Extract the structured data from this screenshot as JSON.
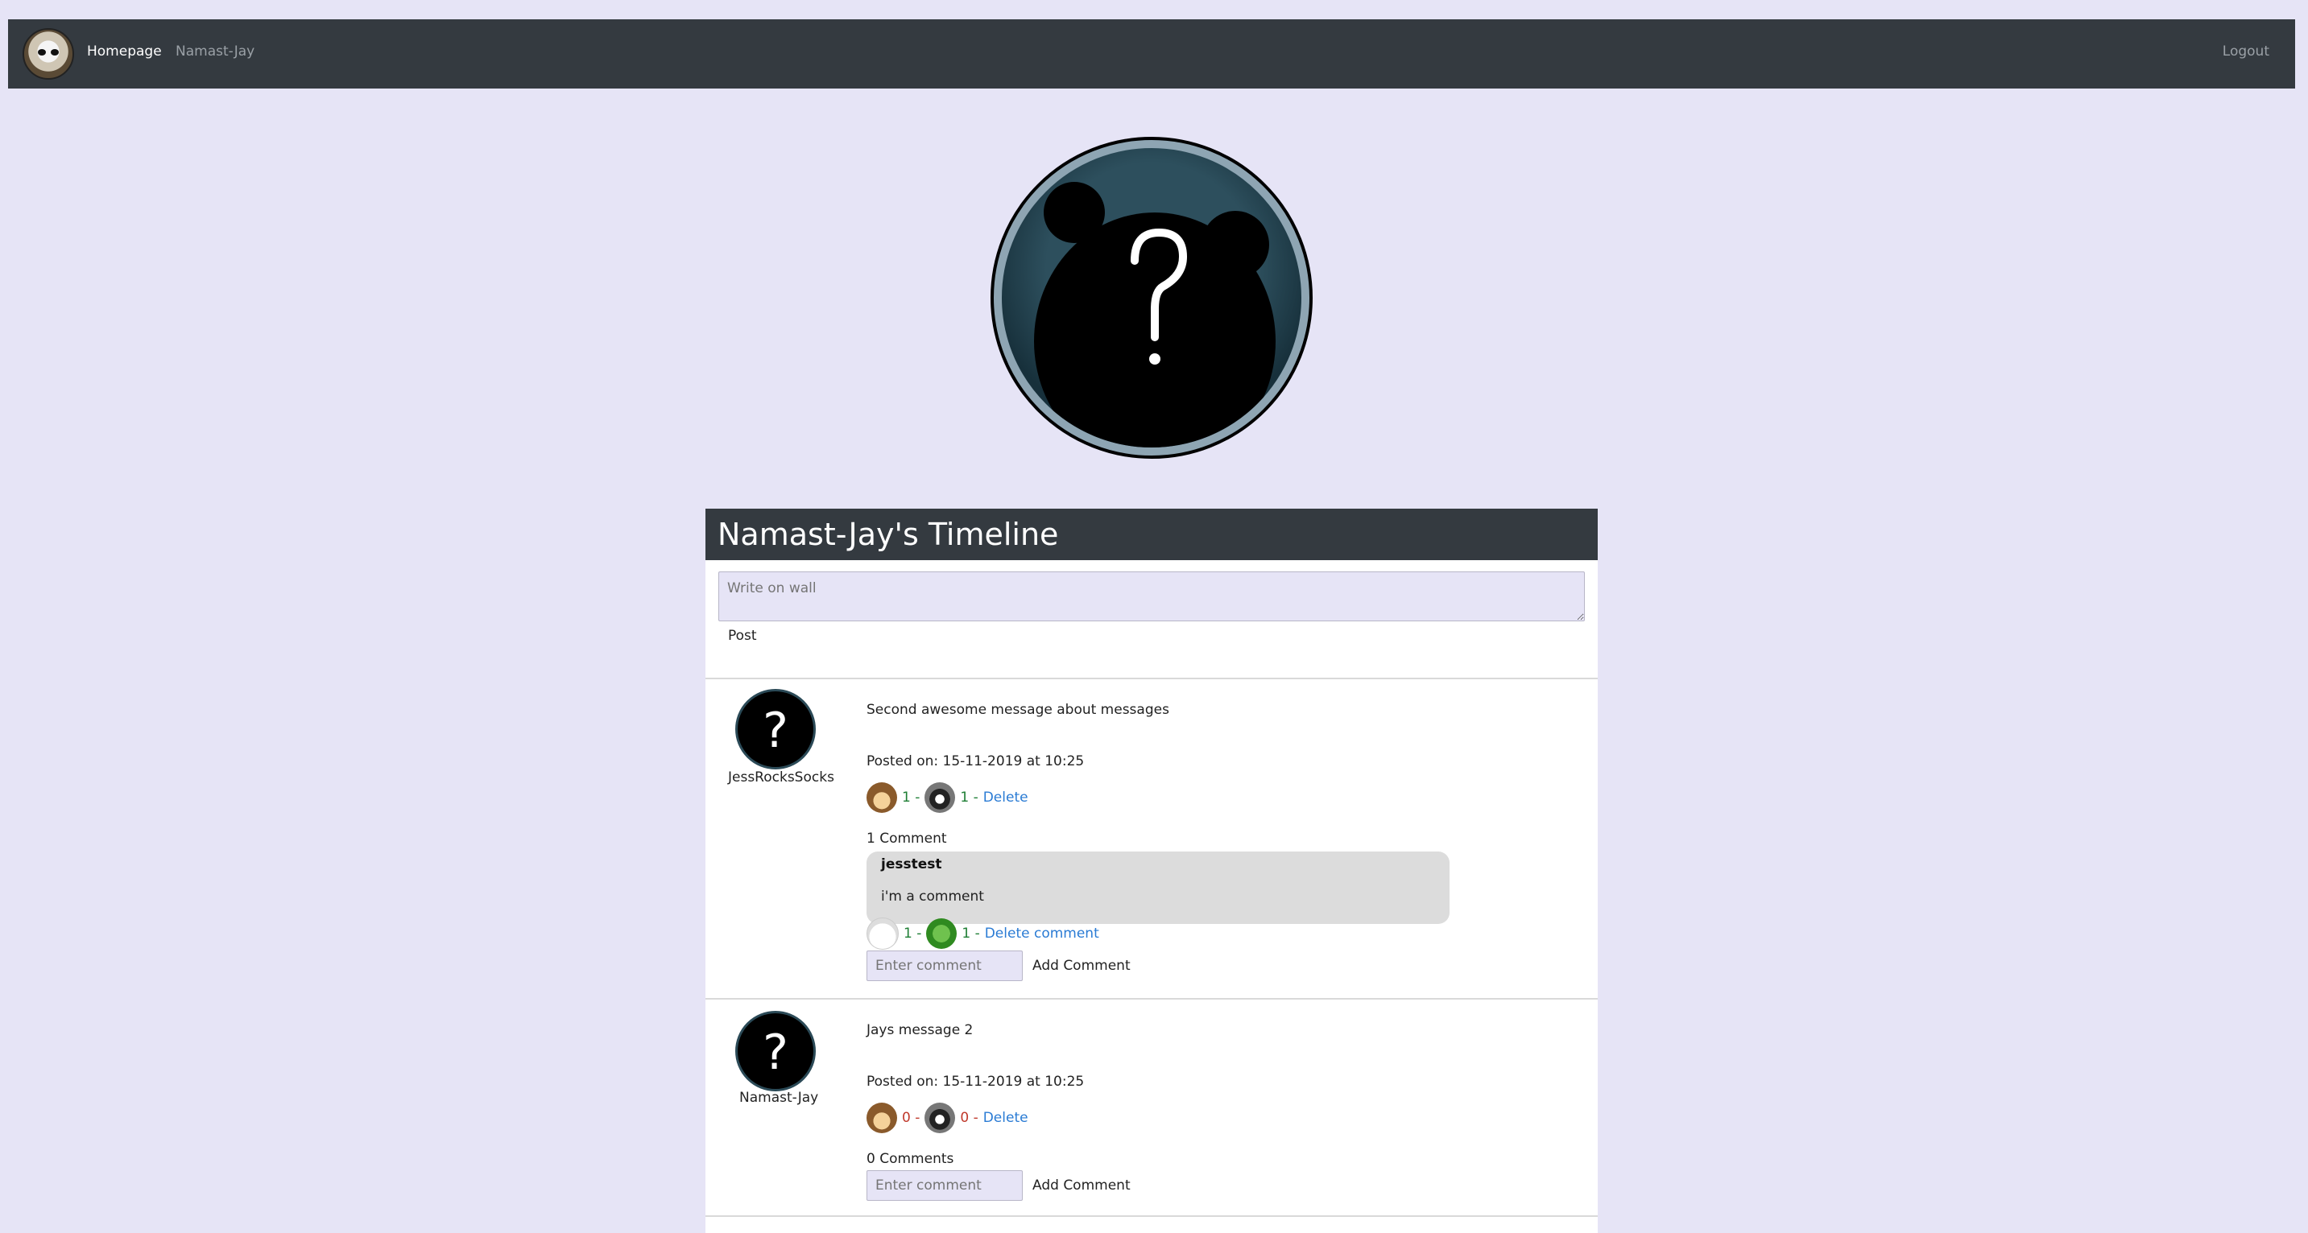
{
  "nav": {
    "brand_icon": "ferret-logo-icon",
    "home_label": "Homepage",
    "user_label": "Namast-Jay",
    "logout_label": "Logout"
  },
  "profile": {
    "avatar_icon": "unknown-user-avatar-icon"
  },
  "timeline": {
    "title": "Namast-Jay's Timeline",
    "wall_placeholder": "Write on wall",
    "post_label": "Post"
  },
  "posts": [
    {
      "author": "JessRocksSocks",
      "message": "Second awesome message about messages",
      "posted": "Posted on: 15-11-2019 at 10:25",
      "reactions": [
        {
          "icon": "hedgehog-icon",
          "count": "1 -"
        },
        {
          "icon": "badger-icon",
          "count": "1 -"
        }
      ],
      "delete_label": "Delete",
      "comment_count": "1 Comment",
      "comments": [
        {
          "author": "jesstest",
          "text": "i'm a comment",
          "reactions": [
            {
              "icon": "rabbit-icon",
              "count": "1 -"
            },
            {
              "icon": "snake-icon",
              "count": "1 -"
            }
          ],
          "delete_label": "Delete comment"
        }
      ],
      "comment_placeholder": "Enter comment",
      "add_comment_label": "Add Comment"
    },
    {
      "author": "Namast-Jay",
      "message": "Jays message 2",
      "posted": "Posted on: 15-11-2019 at 10:25",
      "reactions": [
        {
          "icon": "hedgehog-icon",
          "count": "0 -"
        },
        {
          "icon": "badger-icon",
          "count": "0 -"
        }
      ],
      "delete_label": "Delete",
      "comment_count": "0 Comments",
      "comments": [],
      "comment_placeholder": "Enter comment",
      "add_comment_label": "Add Comment"
    }
  ],
  "colors": {
    "page_bg": "#e6e4f6",
    "navbar_bg": "#343a40",
    "link": "#2a7bd4",
    "count_positive": "#1e7e34",
    "count_zero": "#c0392b"
  }
}
